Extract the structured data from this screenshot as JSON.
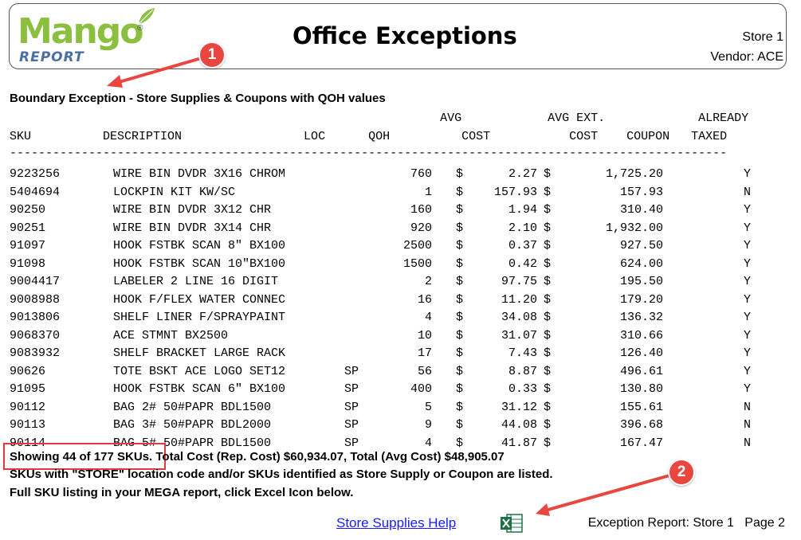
{
  "header": {
    "logo_word": "Mango",
    "logo_sub": "REPORT",
    "logo_reg": "®",
    "title": "Office Exceptions",
    "store": "Store 1",
    "vendor": "Vendor: ACE"
  },
  "section_title": "Boundary Exception - Store Supplies & Coupons with QOH values",
  "table": {
    "header_line1": "                                                            AVG            AVG EXT.             ALREADY",
    "header_line2": "SKU          DESCRIPTION                 LOC      QOH          COST           COST    COUPON   TAXED",
    "rule": "----------------------------------------------------------------------------------------------------",
    "currency_symbol": "$",
    "rows": [
      {
        "sku": "9223256",
        "desc": "WIRE BIN DVDR 3X16 CHROM",
        "loc": "",
        "qoh": "760",
        "cost": "2.27",
        "ext": "1,725.20",
        "taxed": "Y"
      },
      {
        "sku": "5404694",
        "desc": "LOCKPIN KIT KW/SC",
        "loc": "",
        "qoh": "1",
        "cost": "157.93",
        "ext": "157.93",
        "taxed": "N"
      },
      {
        "sku": "90250",
        "desc": "WIRE BIN DVDR 3X12 CHR",
        "loc": "",
        "qoh": "160",
        "cost": "1.94",
        "ext": "310.40",
        "taxed": "Y"
      },
      {
        "sku": "90251",
        "desc": "WIRE BIN DVDR 3X14 CHR",
        "loc": "",
        "qoh": "920",
        "cost": "2.10",
        "ext": "1,932.00",
        "taxed": "Y"
      },
      {
        "sku": "91097",
        "desc": "HOOK FSTBK SCAN 8\" BX100",
        "loc": "",
        "qoh": "2500",
        "cost": "0.37",
        "ext": "927.50",
        "taxed": "Y"
      },
      {
        "sku": "91098",
        "desc": "HOOK FSTBK SCAN 10\"BX100",
        "loc": "",
        "qoh": "1500",
        "cost": "0.42",
        "ext": "624.00",
        "taxed": "Y"
      },
      {
        "sku": "9004417",
        "desc": "LABELER 2 LINE 16 DIGIT",
        "loc": "",
        "qoh": "2",
        "cost": "97.75",
        "ext": "195.50",
        "taxed": "Y"
      },
      {
        "sku": "9008988",
        "desc": "HOOK F/FLEX WATER CONNEC",
        "loc": "",
        "qoh": "16",
        "cost": "11.20",
        "ext": "179.20",
        "taxed": "Y"
      },
      {
        "sku": "9013806",
        "desc": "SHELF LINER F/SPRAYPAINT",
        "loc": "",
        "qoh": "4",
        "cost": "34.08",
        "ext": "136.32",
        "taxed": "Y"
      },
      {
        "sku": "9068370",
        "desc": "ACE STMNT BX2500",
        "loc": "",
        "qoh": "10",
        "cost": "31.07",
        "ext": "310.66",
        "taxed": "Y"
      },
      {
        "sku": "9083932",
        "desc": "SHELF BRACKET LARGE RACK",
        "loc": "",
        "qoh": "17",
        "cost": "7.43",
        "ext": "126.40",
        "taxed": "Y"
      },
      {
        "sku": "90626",
        "desc": "TOTE BSKT ACE LOGO SET12",
        "loc": "SP",
        "qoh": "56",
        "cost": "8.87",
        "ext": "496.61",
        "taxed": "Y"
      },
      {
        "sku": "91095",
        "desc": "HOOK FSTBK SCAN 6\" BX100",
        "loc": "SP",
        "qoh": "400",
        "cost": "0.33",
        "ext": "130.80",
        "taxed": "Y"
      },
      {
        "sku": "90112",
        "desc": "BAG 2# 50#PAPR BDL1500",
        "loc": "SP",
        "qoh": "5",
        "cost": "31.12",
        "ext": "155.61",
        "taxed": "N"
      },
      {
        "sku": "90113",
        "desc": "BAG 3# 50#PAPR BDL2000",
        "loc": "SP",
        "qoh": "9",
        "cost": "44.08",
        "ext": "396.68",
        "taxed": "N"
      },
      {
        "sku": "90114",
        "desc": "BAG 5# 50#PAPR BDL1500",
        "loc": "SP",
        "qoh": "4",
        "cost": "41.87",
        "ext": "167.47",
        "taxed": "N"
      }
    ]
  },
  "summary": {
    "line1": "Showing 44 of 177 SKUs. Total Cost (Rep. Cost) $60,934.07, Total (Avg Cost) $48,905.07",
    "line2": "SKUs with \"STORE\" location code and/or SKUs identified as Store Supply or Coupon are listed.",
    "line3": "Full SKU listing in your MEGA report, click Excel Icon below."
  },
  "footer": {
    "help_link": "Store Supplies Help",
    "report_label": "Exception Report: Store 1",
    "page_label": "Page 2"
  },
  "annotations": {
    "badge1": "1",
    "badge2": "2",
    "color": "#e8473f"
  },
  "icons": {
    "excel": "excel-icon",
    "logo_leaf": "leaf-icon"
  }
}
